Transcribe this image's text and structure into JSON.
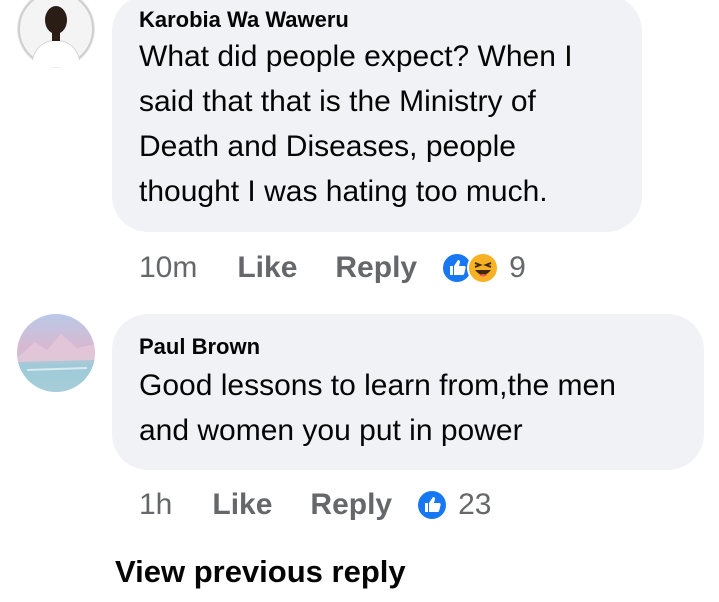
{
  "comments": [
    {
      "author": "Karobia Wa Waweru",
      "text": "What did people expect? When I\nsaid that that is the Ministry of\nDeath and Diseases, people\nthought I was hating too much.",
      "time": "10m",
      "like_label": "Like",
      "reply_label": "Reply",
      "reaction_icons": [
        "like-reaction-icon",
        "haha-reaction-icon"
      ],
      "reaction_count": "9"
    },
    {
      "author": "Paul Brown",
      "text": "Good lessons to learn from,the men\nand women you put in power",
      "time": "1h",
      "like_label": "Like",
      "reply_label": "Reply",
      "reaction_icons": [
        "like-reaction-icon"
      ],
      "reaction_count": "23"
    }
  ],
  "view_previous_label": "View previous reply",
  "colors": {
    "bubble": "#f0f2f5",
    "meta_text": "#65676b",
    "like_blue": "#1877f2",
    "haha_yellow": "#f7b125"
  }
}
